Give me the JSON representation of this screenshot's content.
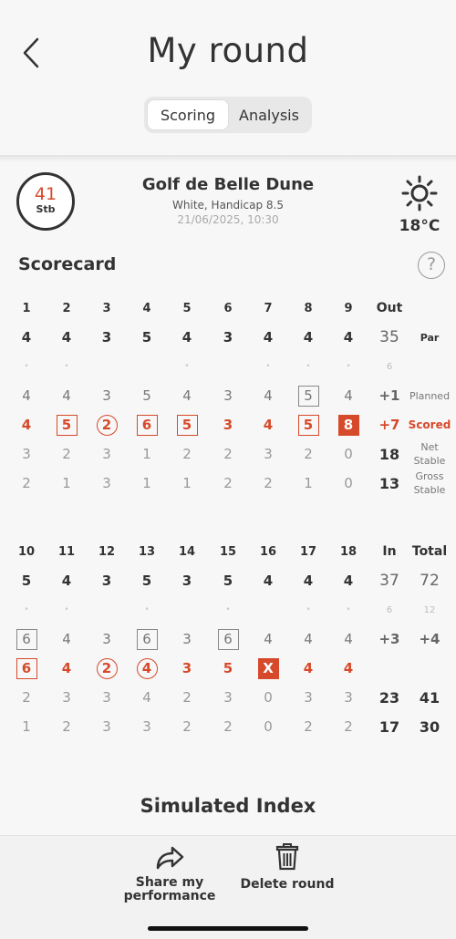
{
  "header": {
    "title": "My round",
    "back_label": "<"
  },
  "tabs": [
    {
      "label": "Scoring",
      "active": true
    },
    {
      "label": "Analysis",
      "active": false
    }
  ],
  "summary": {
    "points": "41",
    "points_unit": "Stb"
  },
  "course": {
    "name": "Golf de Belle Dune",
    "tee_handicap": "White, Handicap 8.5",
    "datetime": "21/06/2025, 10:30"
  },
  "weather": {
    "icon": "sun-icon",
    "temperature": "18°C"
  },
  "scorecard": {
    "title": "Scorecard",
    "help_label": "?",
    "row_labels": {
      "par": "Par",
      "planned": "Planned",
      "scored": "Scored",
      "net": "Net\nStable",
      "gross": "Gross\nStable"
    },
    "front": {
      "holes": [
        "1",
        "2",
        "3",
        "4",
        "5",
        "6",
        "7",
        "8",
        "9"
      ],
      "par": [
        "4",
        "4",
        "3",
        "5",
        "4",
        "3",
        "4",
        "4",
        "4"
      ],
      "stroke_dots": [
        "•",
        "•",
        "",
        "",
        "•",
        "",
        "•",
        "•",
        "•"
      ],
      "planned": [
        "4",
        "4",
        "3",
        "5",
        "4",
        "3",
        "4",
        "5",
        "4"
      ],
      "planned_shape": [
        "",
        "",
        "",
        "",
        "",
        "",
        "",
        "square",
        ""
      ],
      "scored": [
        "4",
        "5",
        "2",
        "6",
        "5",
        "3",
        "4",
        "5",
        "8"
      ],
      "scored_shape": [
        "",
        "square",
        "circle",
        "square",
        "square",
        "",
        "",
        "square",
        "filled"
      ],
      "net": [
        "3",
        "2",
        "3",
        "1",
        "2",
        "2",
        "3",
        "2",
        "0"
      ],
      "gross": [
        "2",
        "1",
        "3",
        "1",
        "1",
        "2",
        "2",
        "1",
        "0"
      ],
      "totals": {
        "header": "Out",
        "par": "35",
        "strokes": "6",
        "planned": "+1",
        "scored": "+7",
        "net": "18",
        "gross": "13"
      }
    },
    "back": {
      "holes": [
        "10",
        "11",
        "12",
        "13",
        "14",
        "15",
        "16",
        "17",
        "18"
      ],
      "par": [
        "5",
        "4",
        "3",
        "5",
        "3",
        "5",
        "4",
        "4",
        "4"
      ],
      "stroke_dots": [
        "•",
        "•",
        "",
        "•",
        "",
        "•",
        "",
        "•",
        "•"
      ],
      "planned": [
        "6",
        "4",
        "3",
        "6",
        "3",
        "6",
        "4",
        "4",
        "4"
      ],
      "planned_shape": [
        "square",
        "",
        "",
        "square",
        "",
        "square",
        "",
        "",
        ""
      ],
      "scored": [
        "6",
        "4",
        "2",
        "4",
        "3",
        "5",
        "X",
        "4",
        "4"
      ],
      "scored_shape": [
        "square",
        "",
        "circle",
        "circle",
        "",
        "",
        "filled",
        "",
        ""
      ],
      "net": [
        "2",
        "3",
        "3",
        "4",
        "2",
        "3",
        "0",
        "3",
        "3"
      ],
      "gross": [
        "1",
        "2",
        "3",
        "3",
        "2",
        "2",
        "0",
        "2",
        "2"
      ],
      "totals": {
        "header": "In",
        "par": "37",
        "strokes": "6",
        "planned": "+3",
        "net": "23",
        "gross": "17"
      },
      "grand_totals": {
        "header": "Total",
        "par": "72",
        "strokes": "12",
        "planned": "+4",
        "net": "41",
        "gross": "30"
      }
    }
  },
  "simulated_index": {
    "title": "Simulated Index"
  },
  "actions": [
    {
      "label": "Share my\nperformance",
      "icon": "share-arrow-icon"
    },
    {
      "label": "Delete round",
      "icon": "trash-icon"
    }
  ],
  "colors": {
    "accent": "#d64a2b",
    "text": "#333333"
  }
}
